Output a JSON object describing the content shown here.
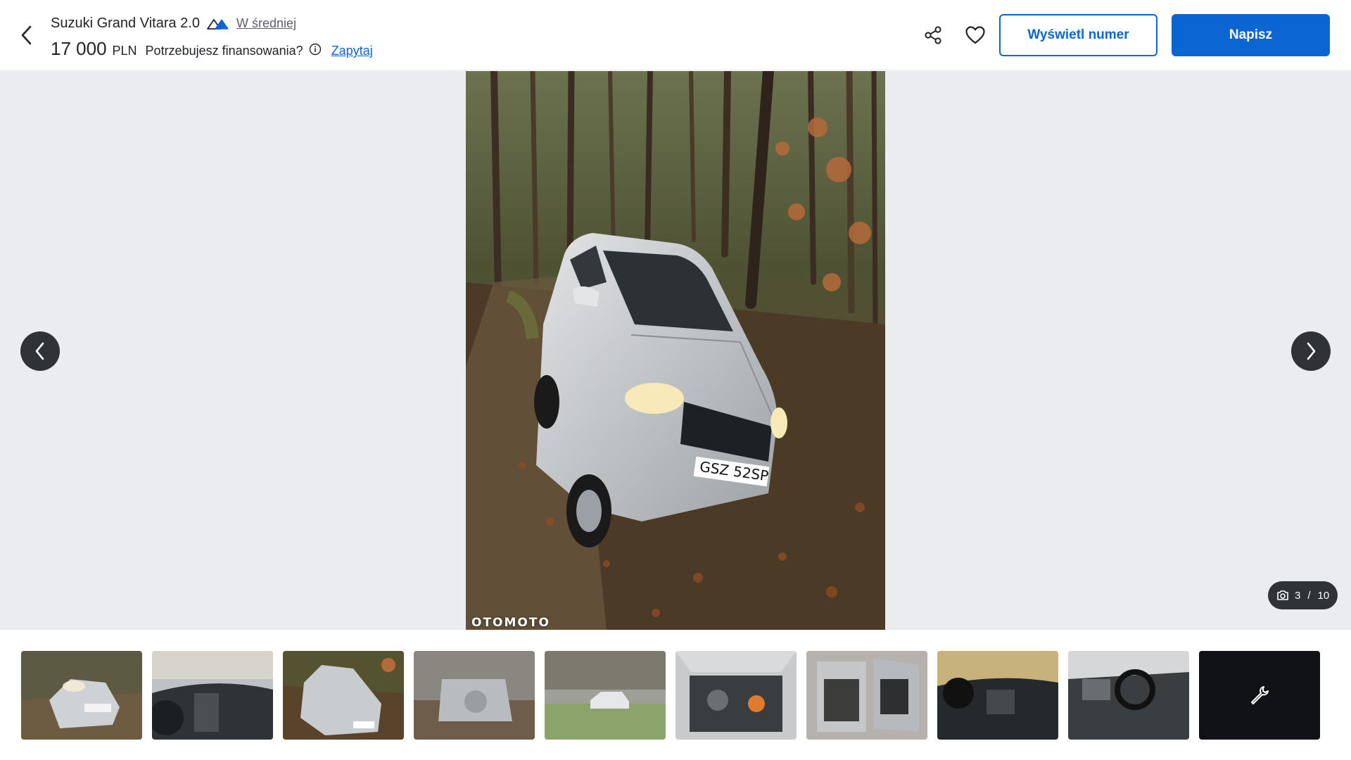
{
  "header": {
    "title": "Suzuki Grand Vitara 2.0",
    "rating_label": "W średniej",
    "price_amount": "17 000",
    "price_currency": "PLN",
    "finance_question": "Potrzebujesz finansowania?",
    "finance_link": "Zapytaj",
    "show_number_label": "Wyświetl numer",
    "write_label": "Napisz"
  },
  "gallery": {
    "watermark": "OTOMOTO",
    "current": "3",
    "total": "10",
    "plate_text": "GSZ 52SP"
  },
  "colors": {
    "accent": "#0b66d4",
    "gallery_bg": "#ebecef",
    "dark_control": "#2f3237"
  },
  "icons": [
    "back-arrow-icon",
    "rating-mountain-icon",
    "info-icon",
    "share-icon",
    "heart-icon",
    "chevron-left-icon",
    "chevron-right-icon",
    "camera-icon",
    "wrench-icon"
  ]
}
